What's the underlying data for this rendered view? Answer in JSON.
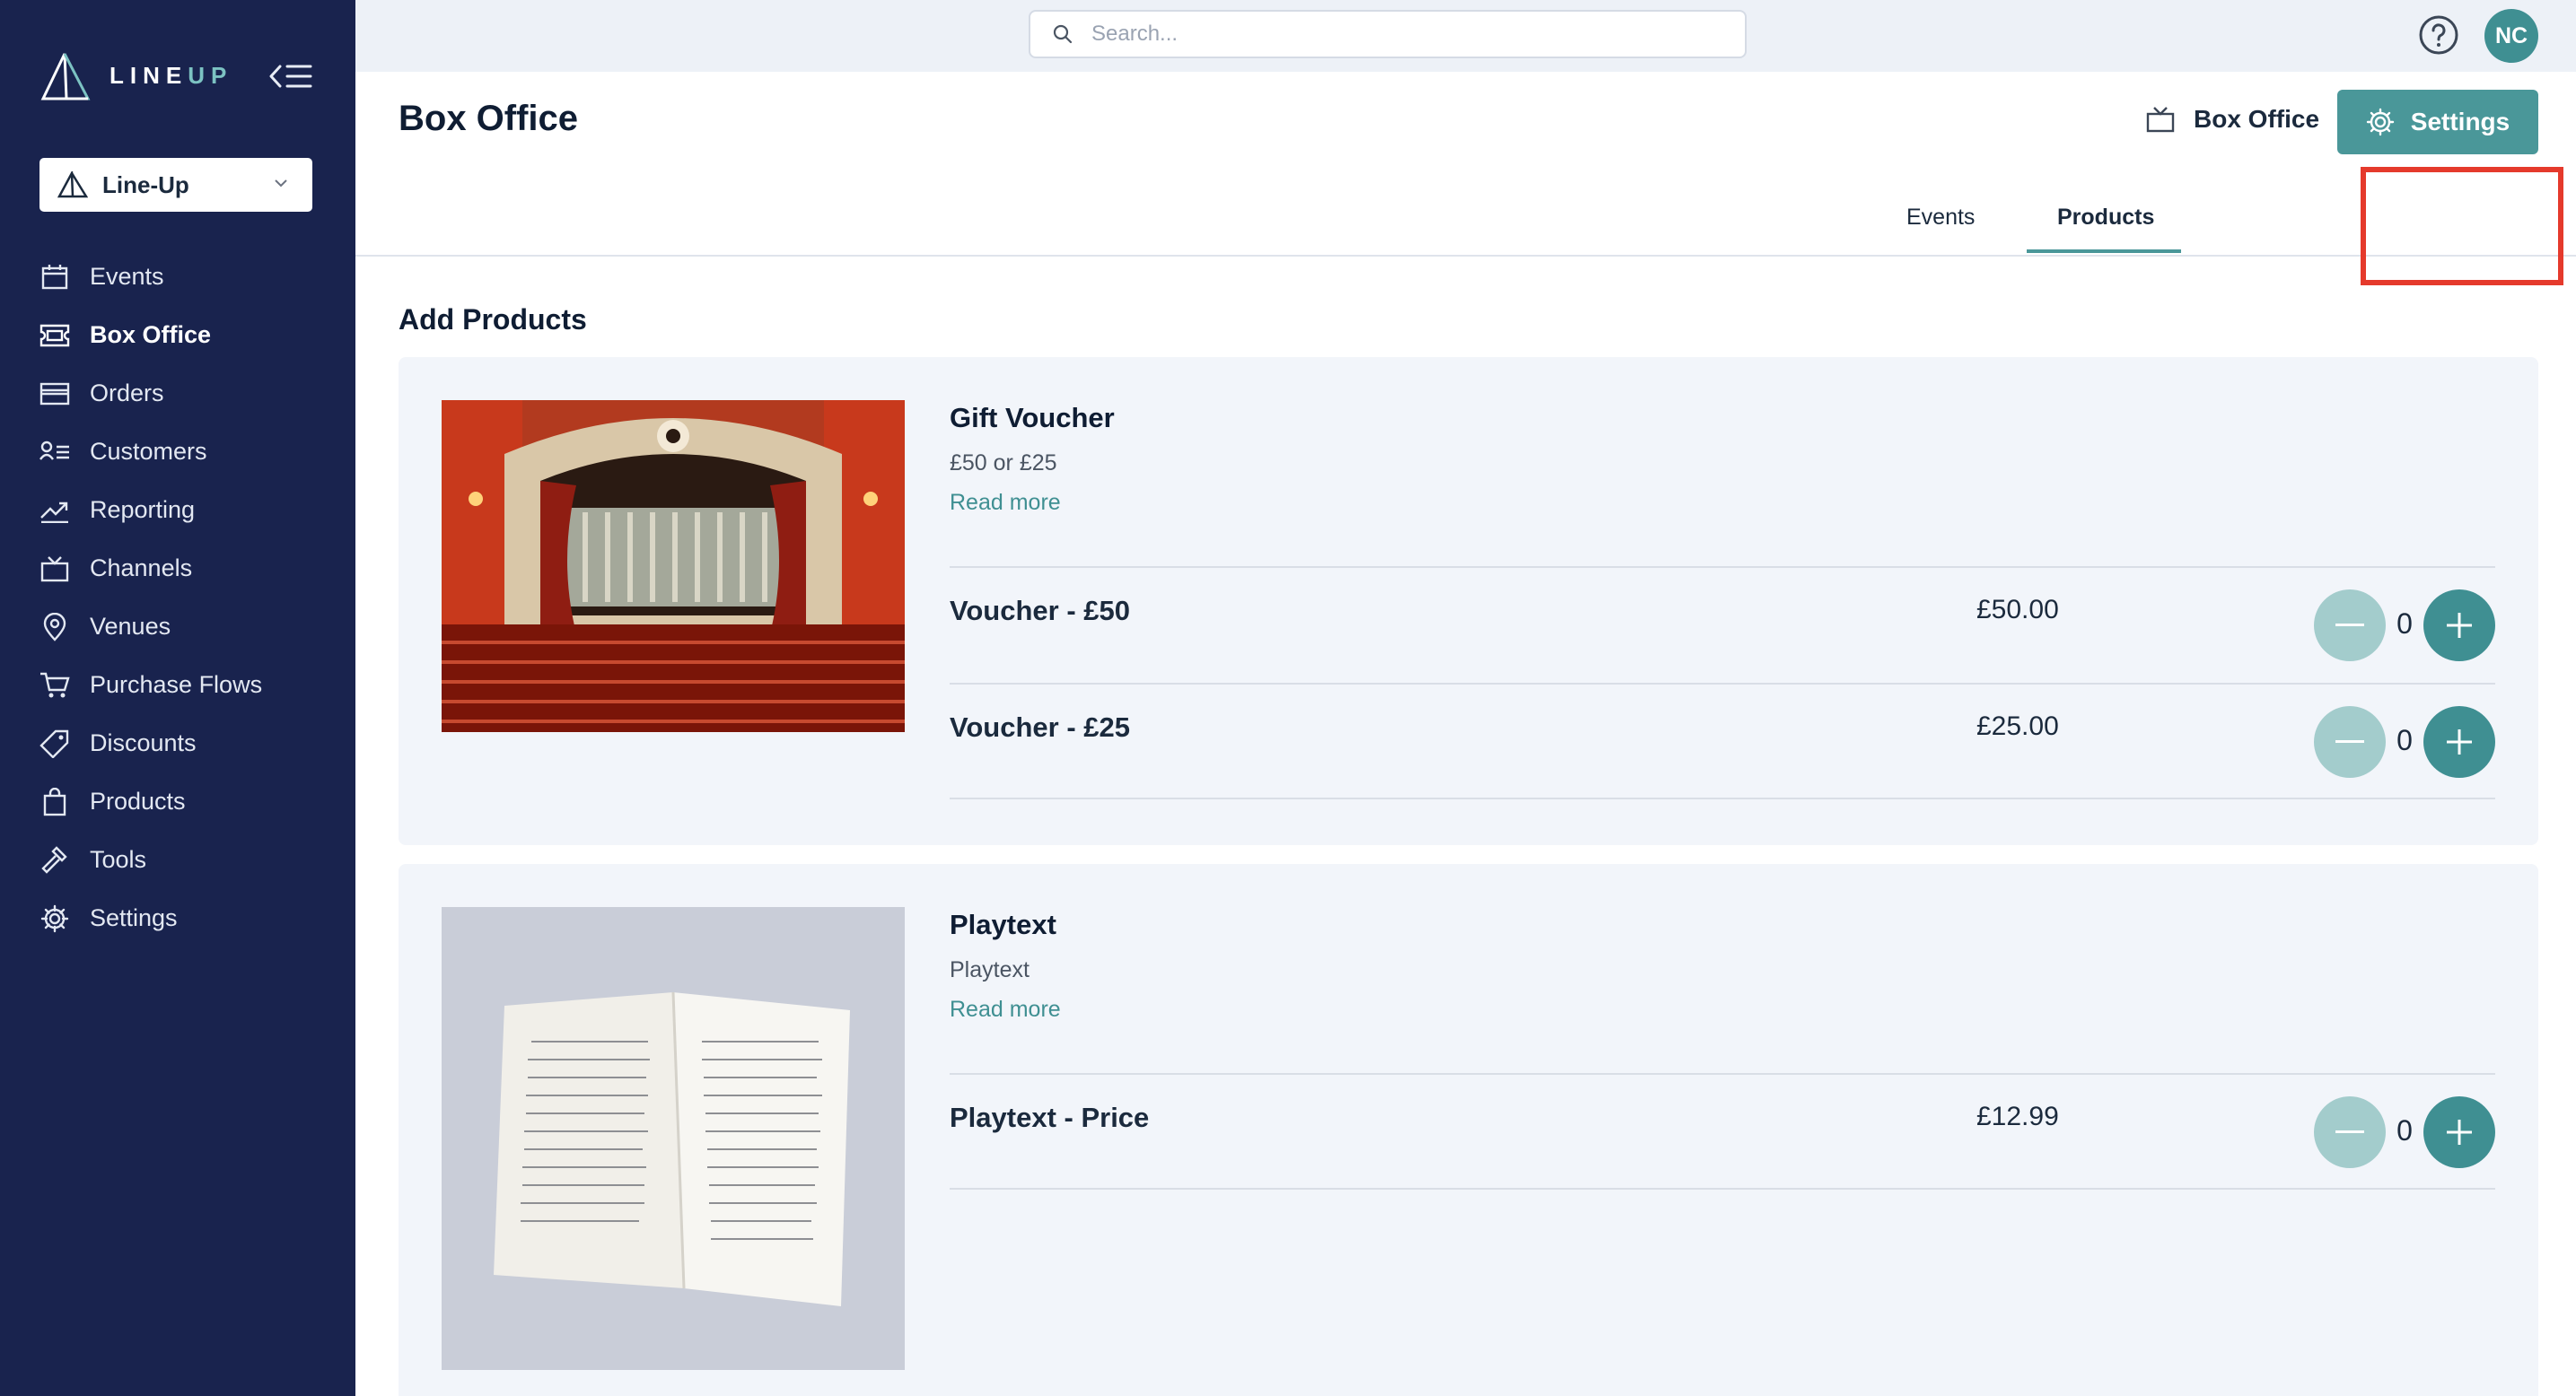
{
  "app": {
    "brand_text_a": "LINE",
    "brand_text_b": "UP",
    "org_name": "Line-Up"
  },
  "sidebar": {
    "items": [
      {
        "label": "Events",
        "icon": "calendar-icon"
      },
      {
        "label": "Box Office",
        "icon": "ticket-icon"
      },
      {
        "label": "Orders",
        "icon": "card-icon"
      },
      {
        "label": "Customers",
        "icon": "customers-icon"
      },
      {
        "label": "Reporting",
        "icon": "trend-icon"
      },
      {
        "label": "Channels",
        "icon": "tv-icon"
      },
      {
        "label": "Venues",
        "icon": "pin-icon"
      },
      {
        "label": "Purchase Flows",
        "icon": "cart-icon"
      },
      {
        "label": "Discounts",
        "icon": "tag-icon"
      },
      {
        "label": "Products",
        "icon": "bag-icon"
      },
      {
        "label": "Tools",
        "icon": "hammer-icon"
      },
      {
        "label": "Settings",
        "icon": "gear-icon"
      }
    ],
    "active": "Box Office"
  },
  "topbar": {
    "search_placeholder": "Search...",
    "avatar_initials": "NC"
  },
  "header": {
    "title": "Box Office",
    "breadcrumb": "Box Office",
    "settings_label": "Settings"
  },
  "tabs": [
    {
      "label": "Events",
      "active": false
    },
    {
      "label": "Products",
      "active": true
    }
  ],
  "main": {
    "section_title": "Add Products",
    "products": [
      {
        "name": "Gift Voucher",
        "description": "£50 or £25",
        "read_more": "Read more",
        "variants": [
          {
            "name": "Voucher - £50",
            "price": "£50.00",
            "qty": "0"
          },
          {
            "name": "Voucher - £25",
            "price": "£25.00",
            "qty": "0"
          }
        ]
      },
      {
        "name": "Playtext",
        "description": "Playtext",
        "read_more": "Read more",
        "variants": [
          {
            "name": "Playtext - Price",
            "price": "£12.99",
            "qty": "0"
          }
        ]
      }
    ]
  },
  "colors": {
    "sidebar_bg": "#19234e",
    "accent": "#4a9799",
    "accent_light": "#a3cccc",
    "highlight": "#e53a2c"
  }
}
